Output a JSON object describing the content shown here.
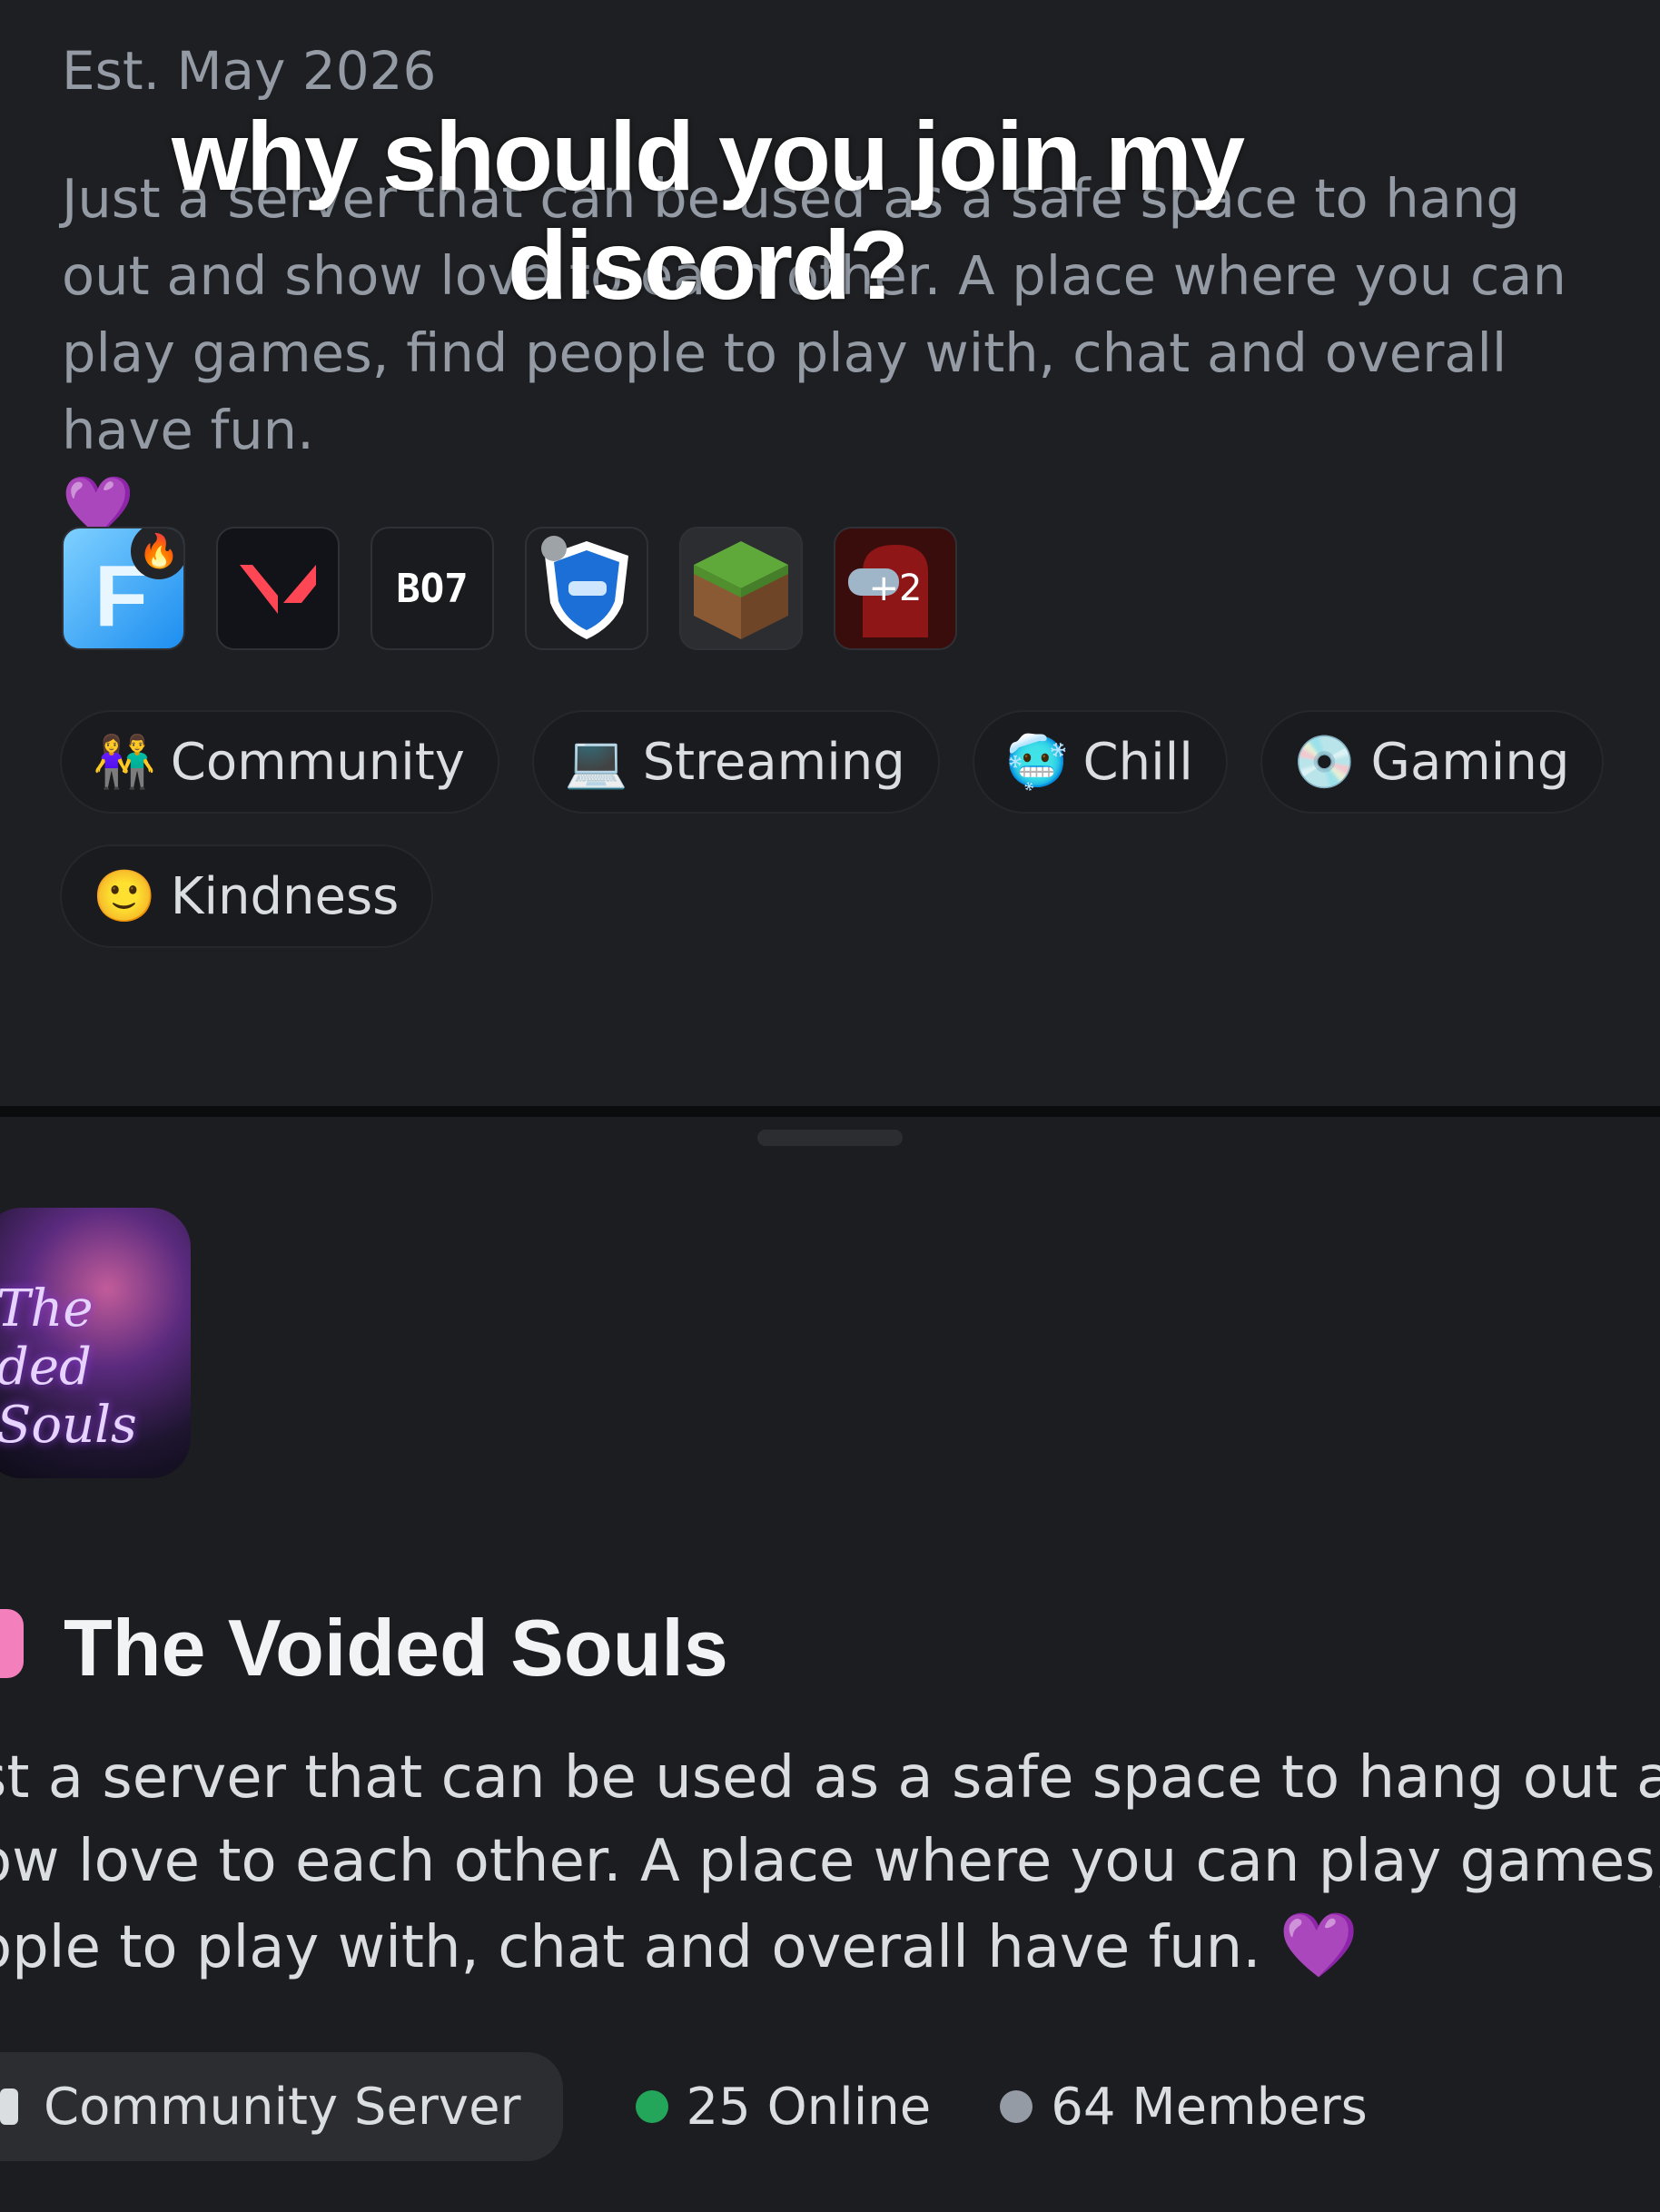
{
  "top_panel": {
    "cut_stats": {
      "online": "25 Online",
      "members": "64 Members"
    },
    "established": "Est. May 2026",
    "description": "Just a server that can be used as a safe space to hang out and show love to each other. A place where you can play games, find people to play with, chat and overall have fun.",
    "heart": "💜",
    "games": [
      {
        "name": "Fortnite",
        "label": "F"
      },
      {
        "name": "Valorant",
        "label": ""
      },
      {
        "name": "BO7",
        "label": "BO7"
      },
      {
        "name": "Rocket League",
        "label": ""
      },
      {
        "name": "Minecraft",
        "label": ""
      },
      {
        "name": "Among Us",
        "label": "+2"
      }
    ],
    "tags": [
      {
        "icon": "👫",
        "label": "Community"
      },
      {
        "icon": "💻",
        "label": "Streaming"
      },
      {
        "icon": "🥶",
        "label": "Chill"
      },
      {
        "icon": "💿",
        "label": "Gaming"
      },
      {
        "icon": "🙂",
        "label": "Kindness"
      }
    ]
  },
  "overlay_caption": {
    "line1": "why should you join my",
    "line2": "discord?"
  },
  "bottom_panel": {
    "server_icon_text": {
      "line1": "The",
      "line2": "ded Souls"
    },
    "server_name": "The Voided Souls",
    "description_lines": [
      "st a server that can be used as a safe space to hang out and",
      "ow love to each other. A place where you can play games, finc",
      "ople to play with, chat and overall have fun."
    ],
    "heart": "💜",
    "community_label": "Community Server",
    "online": "25 Online",
    "members": "64 Members",
    "colors": {
      "online": "#23a55a",
      "members": "#949ba4",
      "accent": "#f47fbd"
    }
  }
}
